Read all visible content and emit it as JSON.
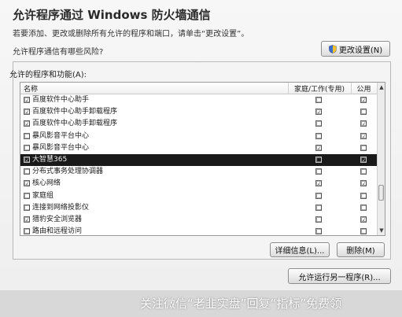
{
  "window": {
    "title": "允许程序通过 Windows 防火墙通信",
    "subtitle": "若要添加、更改或删除所有允许的程序和端口，请单击“更改设置”。",
    "question": "允许程序通信有哪些风险?",
    "change_settings_label": "更改设置(N)"
  },
  "allowed": {
    "group_label": "允许的程序和功能(A):",
    "columns": {
      "name": "名称",
      "home_work": "家庭/工作(专用)",
      "public": "公用"
    },
    "rows": [
      {
        "name": "百度软件中心助手",
        "name_checked": "☑",
        "home": "☐",
        "public": "☑"
      },
      {
        "name": "百度软件中心助手卸载程序",
        "name_checked": "☑",
        "home": "☑",
        "public": "☐"
      },
      {
        "name": "百度软件中心助手卸载程序",
        "name_checked": "☑",
        "home": "☐",
        "public": "☑"
      },
      {
        "name": "暴风影音平台中心",
        "name_checked": "☐",
        "home": "☐",
        "public": "☑"
      },
      {
        "name": "暴风影音平台中心",
        "name_checked": "☐",
        "home": "☑",
        "public": "☐"
      },
      {
        "name": "大智慧365",
        "name_checked": "☑",
        "home": "☐",
        "public": "☑"
      },
      {
        "name": "分布式事务处理协调器",
        "name_checked": "☐",
        "home": "☐",
        "public": "☐"
      },
      {
        "name": "核心网络",
        "name_checked": "☑",
        "home": "☑",
        "public": "☑"
      },
      {
        "name": "家庭组",
        "name_checked": "☐",
        "home": "☐",
        "public": "☐"
      },
      {
        "name": "连接到网络投影仪",
        "name_checked": "☐",
        "home": "☐",
        "public": "☐"
      },
      {
        "name": "猎豹安全浏览器",
        "name_checked": "☑",
        "home": "☐",
        "public": "☑"
      },
      {
        "name": "路由和远程访问",
        "name_checked": "☐",
        "home": "☐",
        "public": "☐"
      }
    ],
    "selected_row": "大智慧365",
    "details_label": "详细信息(L)...",
    "remove_label": "删除(M)"
  },
  "footer": {
    "allow_another_label": "允许运行另一程序(R)..."
  },
  "watermark": {
    "text": "关注微信“老韭实盘”回复“指标”免费领"
  },
  "icons": {
    "change_settings": "shield-icon",
    "scroll_up": "arrow-up-icon",
    "scroll_down": "arrow-down-icon"
  }
}
